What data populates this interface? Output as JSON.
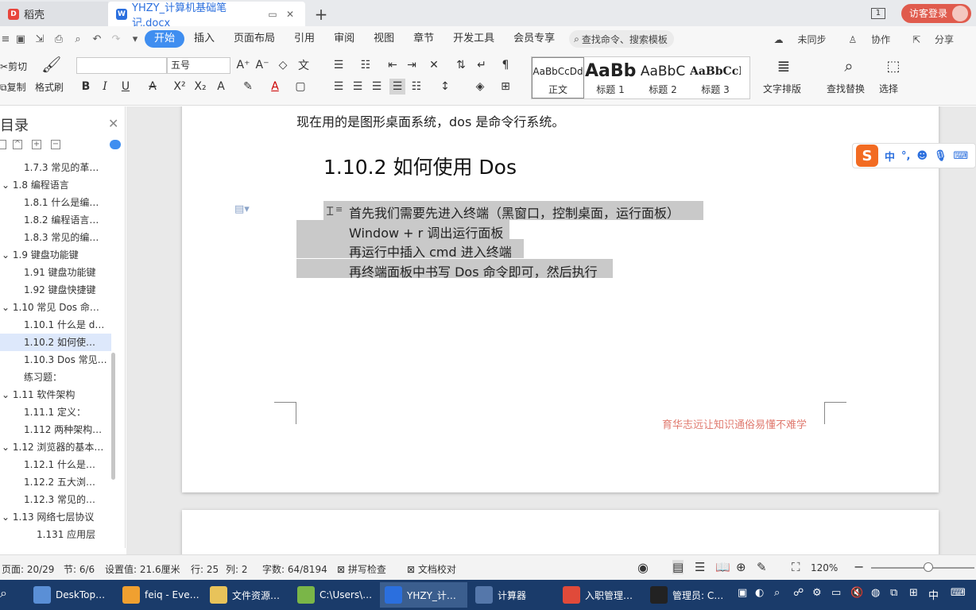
{
  "tabs": {
    "daoke": "稻壳",
    "doc": "YHZY_计算机基础笔记.docx",
    "new_tab": "+",
    "page_indicator": "1",
    "login": "访客登录"
  },
  "menu": {
    "items": [
      "开始",
      "插入",
      "页面布局",
      "引用",
      "审阅",
      "视图",
      "章节",
      "开发工具",
      "会员专享"
    ],
    "search_placeholder": "查找命令、搜索模板",
    "unsynced": "未同步",
    "collab": "协作",
    "share": "分享"
  },
  "ribbon": {
    "cut": "剪切",
    "copy": "复制",
    "format_painter": "格式刷",
    "font_name": "",
    "font_size": "五号",
    "styles": [
      {
        "sample": "AaBbCcDd",
        "name": "正文"
      },
      {
        "sample": "AaBb",
        "name": "标题 1"
      },
      {
        "sample": "AaBbC",
        "name": "标题 2"
      },
      {
        "sample": "AaBbCcI",
        "name": "标题 3"
      }
    ],
    "text_layout": "文字排版",
    "find_replace": "查找替换",
    "select": "选择"
  },
  "nav": {
    "title": "目录",
    "items": [
      {
        "label": "1.7.3  常见的革…",
        "level": 2
      },
      {
        "label": "1.8  编程语言",
        "level": 1
      },
      {
        "label": "1.8.1  什么是编…",
        "level": 2
      },
      {
        "label": "1.8.2 编程语言…",
        "level": 2
      },
      {
        "label": "1.8.3  常见的编…",
        "level": 2
      },
      {
        "label": "1.9 键盘功能键",
        "level": 1
      },
      {
        "label": "1.91  键盘功能键",
        "level": 2
      },
      {
        "label": "1.92 键盘快捷键",
        "level": 2
      },
      {
        "label": "1.10  常见 Dos 命…",
        "level": 1
      },
      {
        "label": "1.10.1  什么是 d…",
        "level": 2
      },
      {
        "label": "1.10.2  如何使…",
        "level": 2,
        "selected": true
      },
      {
        "label": "1.10.3 Dos 常见…",
        "level": 2
      },
      {
        "label": "练习题：",
        "level": 2
      },
      {
        "label": "1.11 软件架构",
        "level": 1
      },
      {
        "label": "1.11.1  定义：",
        "level": 2
      },
      {
        "label": "1.112  两种架构…",
        "level": 2
      },
      {
        "label": "1.12  浏览器的基本…",
        "level": 1
      },
      {
        "label": "1.12.1  什么是…",
        "level": 2
      },
      {
        "label": "1.12.2  五大浏…",
        "level": 2
      },
      {
        "label": "1.12.3  常见的…",
        "level": 2
      },
      {
        "label": "1.13 网络七层协议",
        "level": 1
      },
      {
        "label": "1.131 应用层",
        "level": 3
      }
    ]
  },
  "document": {
    "intro_line": "现在用的是图形桌面系统，dos 是命令行系统。",
    "heading": "1.10.2  如何使用 Dos",
    "lines": [
      "首先我们需要先进入终端（黑窗口，控制桌面，运行面板）",
      "Window + r  调出运行面板",
      "再运行中插入 cmd  进入终端",
      "再终端面板中书写 Dos 命令即可，然后执行"
    ],
    "footer": "育华志远让知识通俗易懂不难学"
  },
  "ime": {
    "mode": "中"
  },
  "status": {
    "page": "页面: 20/29",
    "section": "节: 6/6",
    "setting": "设置值: 21.6厘米",
    "row": "行: 25",
    "col": "列: 2",
    "wordcount": "字数: 64/8194",
    "spell": "拼写检查",
    "proof": "文档校对",
    "zoom": "120%"
  },
  "taskbar": {
    "items": [
      {
        "label": "DeskTop…",
        "color": "#5a8fd6"
      },
      {
        "label": "feiq - Eve…",
        "color": "#f0a030"
      },
      {
        "label": "文件资源…",
        "color": "#e8c35a"
      },
      {
        "label": "C:\\Users\\…",
        "color": "#7ab648"
      },
      {
        "label": "YHZY_计…",
        "color": "#2b6fde"
      },
      {
        "label": "计算器",
        "color": "#5577aa"
      },
      {
        "label": "入职管理…",
        "color": "#e04a3a"
      },
      {
        "label": "管理员: C…",
        "color": "#222222"
      }
    ],
    "ime_label": "中"
  }
}
